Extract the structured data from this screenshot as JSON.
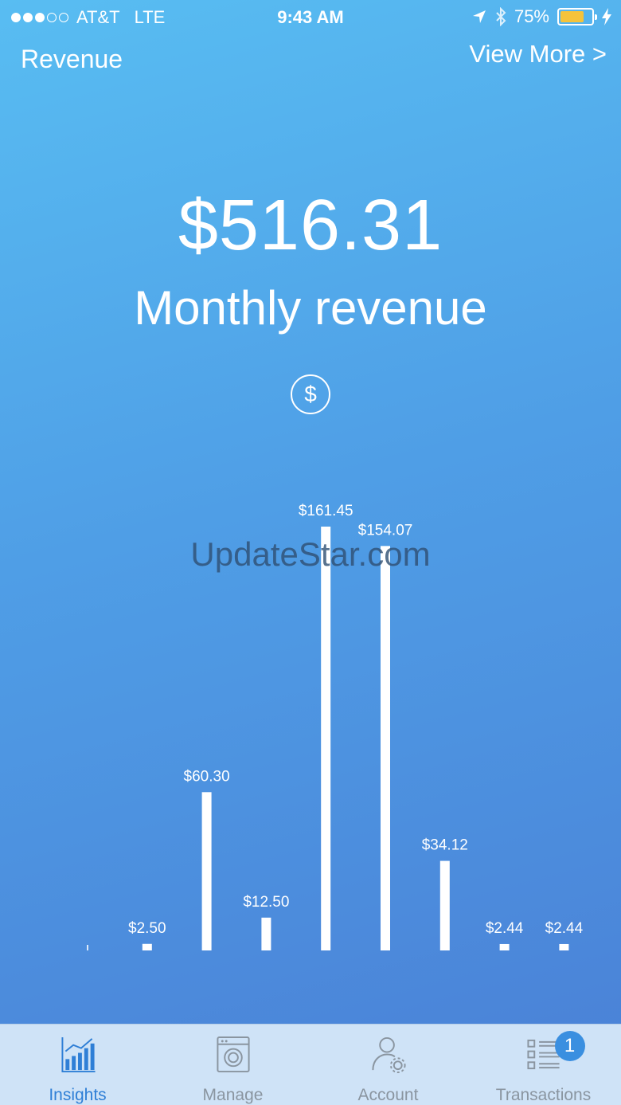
{
  "status": {
    "carrier": "AT&T",
    "network": "LTE",
    "time": "9:43 AM",
    "battery": "75%",
    "battery_level": 0.75,
    "signal_strength": 3,
    "signal_total": 5,
    "battery_color": "#f5c33b"
  },
  "header": {
    "title": "Revenue",
    "link": "View More >"
  },
  "summary": {
    "amount": "$516.31",
    "label": "Monthly revenue",
    "icon": "dollar-circle-icon",
    "icon_glyph": "$"
  },
  "watermark": "UpdateStar.com",
  "chart_data": {
    "type": "bar",
    "categories": [
      "",
      "",
      "",
      "",
      "",
      "",
      "",
      "",
      ""
    ],
    "values": [
      0,
      2.5,
      60.3,
      12.5,
      161.45,
      154.07,
      34.12,
      2.44,
      2.44
    ],
    "data_labels": [
      "",
      "$2.50",
      "$60.30",
      "$12.50",
      "$161.45",
      "$154.07",
      "$34.12",
      "$2.44",
      "$2.44"
    ],
    "ylim": [
      0,
      161.45
    ],
    "grid": false,
    "bar_color": "#ffffff"
  },
  "tabs": [
    {
      "label": "Insights",
      "icon": "bar-chart-icon",
      "active": true
    },
    {
      "label": "Manage",
      "icon": "washing-machine-icon",
      "active": false
    },
    {
      "label": "Account",
      "icon": "user-settings-icon",
      "active": false
    },
    {
      "label": "Transactions",
      "icon": "list-icon",
      "active": false,
      "badge": "1"
    }
  ],
  "colors": {
    "accent": "#2f7fd6",
    "tab_inactive": "#8a95a0",
    "tabbar_bg": "#cfe3f7",
    "badge": "#3a8fe0"
  }
}
